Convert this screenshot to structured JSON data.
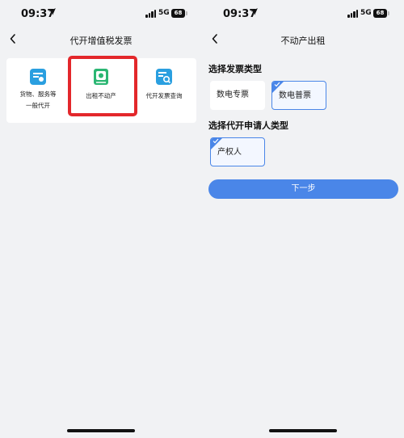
{
  "left_screen": {
    "status": {
      "time": "09:37",
      "network": "5G",
      "battery": "68"
    },
    "nav": {
      "title": "代开增值税发票"
    },
    "menu": [
      {
        "label_line1": "货物、服务等",
        "label_line2": "一般代开",
        "icon": "invoice-box-icon",
        "color": "#2a9fe0"
      },
      {
        "label_line1": "出租不动产",
        "label_line2": "",
        "icon": "property-book-icon",
        "color": "#2bb673"
      },
      {
        "label_line1": "代开发票查询",
        "label_line2": "",
        "icon": "invoice-search-icon",
        "color": "#2a9fe0"
      }
    ],
    "highlight_color": "#e3272b"
  },
  "right_screen": {
    "status": {
      "time": "09:37",
      "network": "5G",
      "battery": "68"
    },
    "nav": {
      "title": "不动产出租"
    },
    "invoice_type": {
      "title": "选择发票类型",
      "options": [
        {
          "label": "数电专票",
          "selected": false
        },
        {
          "label": "数电普票",
          "selected": true
        }
      ]
    },
    "applicant_type": {
      "title": "选择代开申请人类型",
      "options": [
        {
          "label": "产权人",
          "selected": true
        }
      ]
    },
    "next_button": {
      "label": "下一步"
    },
    "accent_color": "#4a86e8"
  }
}
